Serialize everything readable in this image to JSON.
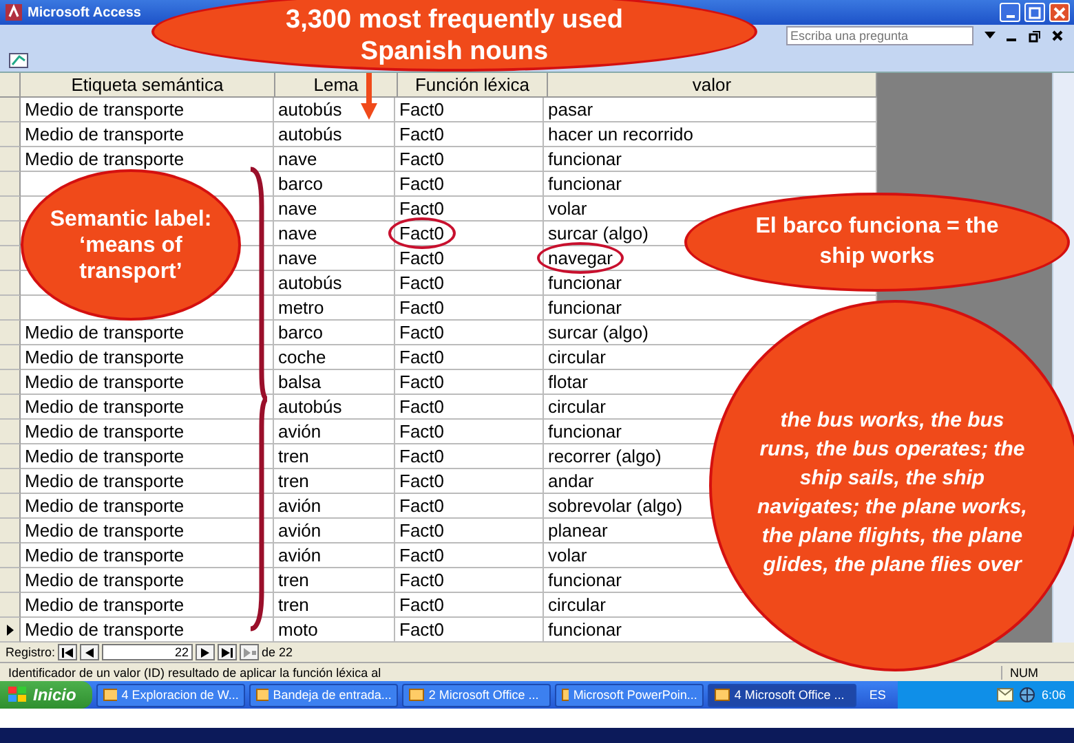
{
  "window": {
    "title": "Microsoft Access"
  },
  "help_search": {
    "placeholder": "Escriba una pregunta"
  },
  "table": {
    "columns": [
      "Etiqueta semántica",
      "Lema",
      "Función léxica",
      "valor"
    ],
    "rows": [
      {
        "label": "Medio de transporte",
        "lemma": "autobús",
        "function": "Fact0",
        "value": "pasar",
        "selected": false,
        "function_circled": false,
        "value_circled": false
      },
      {
        "label": "Medio de transporte",
        "lemma": "autobús",
        "function": "Fact0",
        "value": "hacer un recorrido",
        "selected": false,
        "function_circled": false,
        "value_circled": false
      },
      {
        "label": "Medio de transporte",
        "lemma": "nave",
        "function": "Fact0",
        "value": "funcionar",
        "selected": false,
        "function_circled": false,
        "value_circled": false
      },
      {
        "lemma": "barco",
        "function": "Fact0",
        "value": "funcionar",
        "selected": false,
        "function_circled": false,
        "value_circled": false
      },
      {
        "lemma": "nave",
        "function": "Fact0",
        "value": "volar",
        "selected": false,
        "function_circled": false,
        "value_circled": false
      },
      {
        "lemma": "nave",
        "function": "Fact0",
        "value": "surcar (algo)",
        "selected": false,
        "function_circled": true,
        "value_circled": false
      },
      {
        "lemma": "nave",
        "function": "Fact0",
        "value": "navegar",
        "selected": false,
        "function_circled": false,
        "value_circled": true
      },
      {
        "lemma": "autobús",
        "function": "Fact0",
        "value": "funcionar",
        "selected": false,
        "function_circled": false,
        "value_circled": false
      },
      {
        "lemma": "metro",
        "function": "Fact0",
        "value": "funcionar",
        "selected": false,
        "function_circled": false,
        "value_circled": false
      },
      {
        "label": "Medio de transporte",
        "lemma": "barco",
        "function": "Fact0",
        "value": "surcar (algo)",
        "selected": false,
        "function_circled": false,
        "value_circled": false
      },
      {
        "label": "Medio de transporte",
        "lemma": "coche",
        "function": "Fact0",
        "value": "circular",
        "selected": false,
        "function_circled": false,
        "value_circled": false
      },
      {
        "label": "Medio de transporte",
        "lemma": "balsa",
        "function": "Fact0",
        "value": "flotar",
        "selected": false,
        "function_circled": false,
        "value_circled": false
      },
      {
        "label": "Medio de transporte",
        "lemma": "autobús",
        "function": "Fact0",
        "value": "circular",
        "selected": false,
        "function_circled": false,
        "value_circled": false
      },
      {
        "label": "Medio de transporte",
        "lemma": "avión",
        "function": "Fact0",
        "value": "funcionar",
        "selected": false,
        "function_circled": false,
        "value_circled": false
      },
      {
        "label": "Medio de transporte",
        "lemma": "tren",
        "function": "Fact0",
        "value": "recorrer (algo)",
        "selected": false,
        "function_circled": false,
        "value_circled": false
      },
      {
        "label": "Medio de transporte",
        "lemma": "tren",
        "function": "Fact0",
        "value": "andar",
        "selected": false,
        "function_circled": false,
        "value_circled": false
      },
      {
        "label": "Medio de transporte",
        "lemma": "avión",
        "function": "Fact0",
        "value": "sobrevolar (algo)",
        "selected": false,
        "function_circled": false,
        "value_circled": false
      },
      {
        "label": "Medio de transporte",
        "lemma": "avión",
        "function": "Fact0",
        "value": "planear",
        "selected": false,
        "function_circled": false,
        "value_circled": false
      },
      {
        "label": "Medio de transporte",
        "lemma": "avión",
        "function": "Fact0",
        "value": "volar",
        "selected": false,
        "function_circled": false,
        "value_circled": false
      },
      {
        "label": "Medio de transporte",
        "lemma": "tren",
        "function": "Fact0",
        "value": "funcionar",
        "selected": false,
        "function_circled": false,
        "value_circled": false
      },
      {
        "label": "Medio de transporte",
        "lemma": "tren",
        "function": "Fact0",
        "value": "circular",
        "selected": false,
        "function_circled": false,
        "value_circled": false
      },
      {
        "label": "Medio de transporte",
        "lemma": "moto",
        "function": "Fact0",
        "value": "funcionar",
        "selected": true,
        "function_circled": false,
        "value_circled": false
      }
    ]
  },
  "record_nav": {
    "label": "Registro:",
    "current": "22",
    "total": "de 22"
  },
  "status_bar": {
    "text": "Identificador de un valor (ID) resultado de aplicar la función léxica al",
    "indicator": "NUM"
  },
  "taskbar": {
    "start": "Inicio",
    "buttons": [
      {
        "label": "4 Exploracion de W...",
        "selected": false
      },
      {
        "label": "Bandeja de entrada...",
        "selected": false
      },
      {
        "label": "2 Microsoft Office ...",
        "selected": false
      },
      {
        "label": "Microsoft PowerPoin...",
        "selected": false
      },
      {
        "label": "4 Microsoft Office ...",
        "selected": true
      }
    ],
    "language": "ES",
    "clock": "6:06"
  },
  "annotations": {
    "title_callout": "3,300 most frequently used Spanish nouns",
    "label_callout": "Semantic label: ‘means of transport’",
    "example_callout": "El barco funciona = the ship works",
    "translation_callout": "the bus works, the bus runs, the bus operates; the ship sails, the ship navigates; the plane works, the plane flights, the plane glides, the plane flies over"
  }
}
